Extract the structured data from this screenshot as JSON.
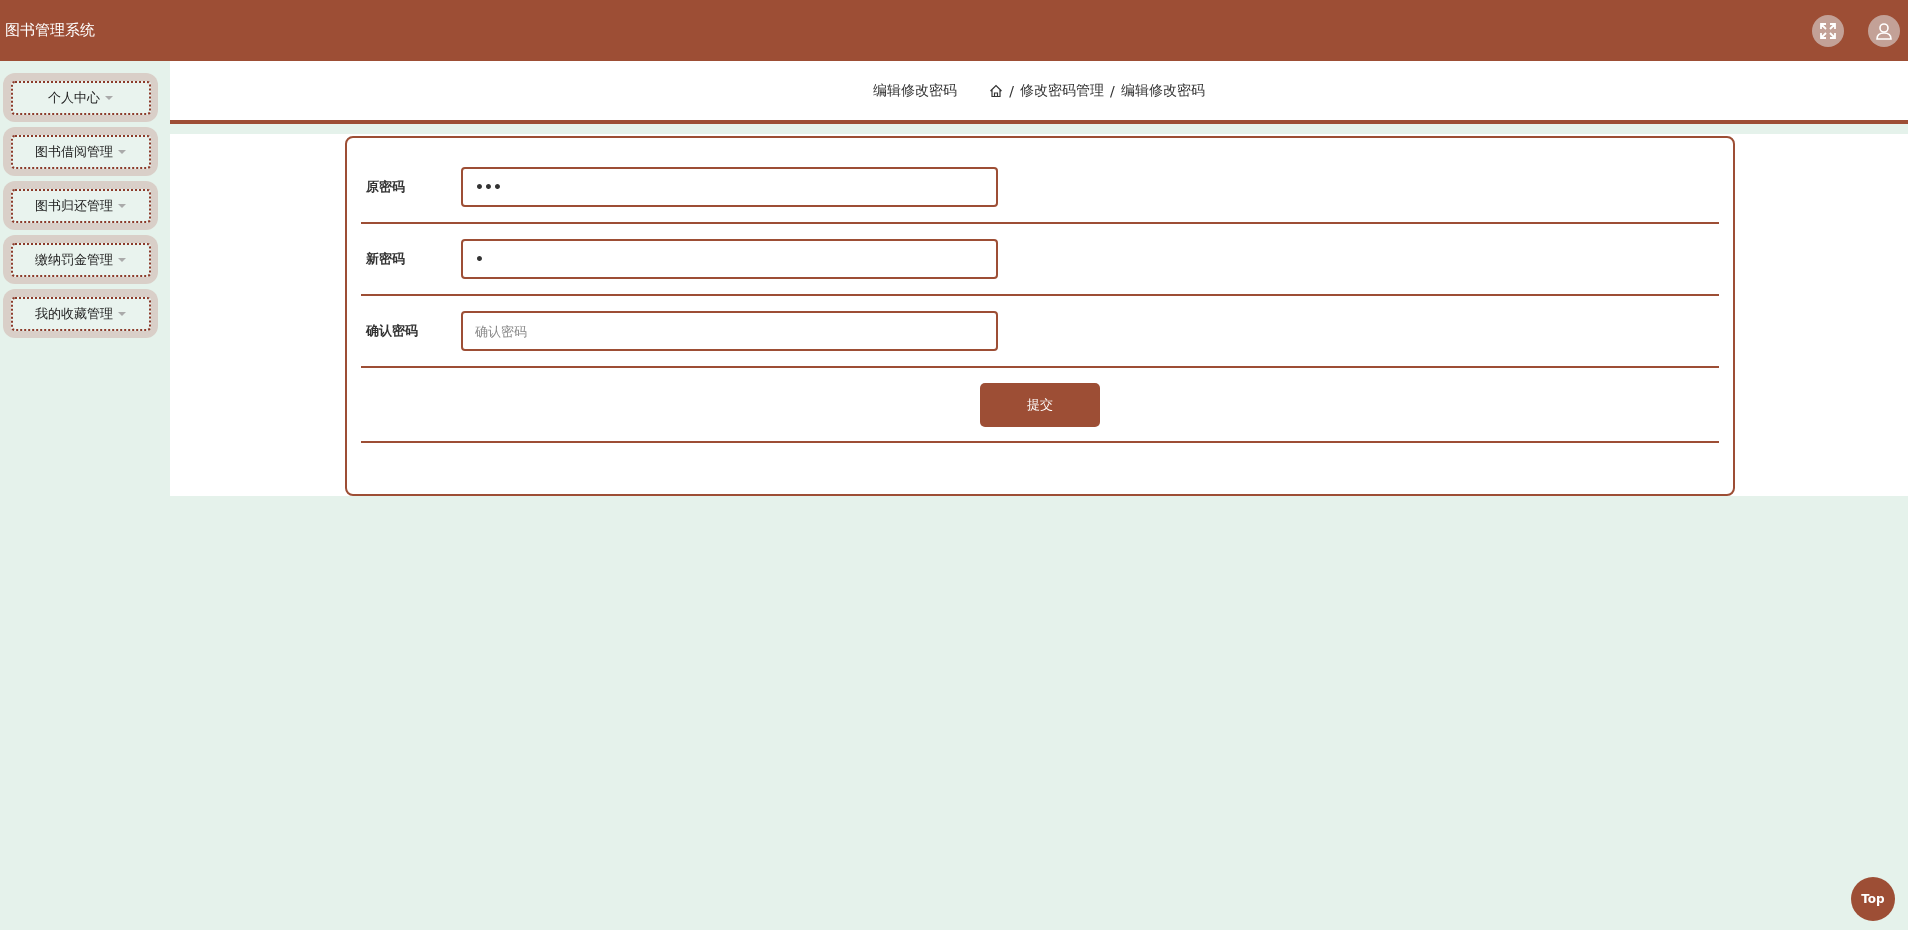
{
  "header": {
    "title": "图书管理系统"
  },
  "sidebar": {
    "items": [
      {
        "label": "个人中心",
        "expanded": false
      },
      {
        "label": "图书借阅管理",
        "expanded": false
      },
      {
        "label": "图书归还管理",
        "expanded": false
      },
      {
        "label": "缴纳罚金管理",
        "expanded": false
      },
      {
        "label": "我的收藏管理",
        "expanded": false
      }
    ]
  },
  "page_title": "编辑修改密码",
  "breadcrumb": [
    {
      "separator": "/",
      "label": "修改密码管理"
    },
    {
      "separator": "/",
      "label": "编辑修改密码"
    }
  ],
  "form": {
    "fields": [
      {
        "label": "原密码",
        "value": "•••"
      },
      {
        "label": "新密码",
        "value": "•"
      },
      {
        "label": "确认密码",
        "placeholder": "确认密码"
      }
    ],
    "submit": "提交"
  },
  "top_button": "Top"
}
